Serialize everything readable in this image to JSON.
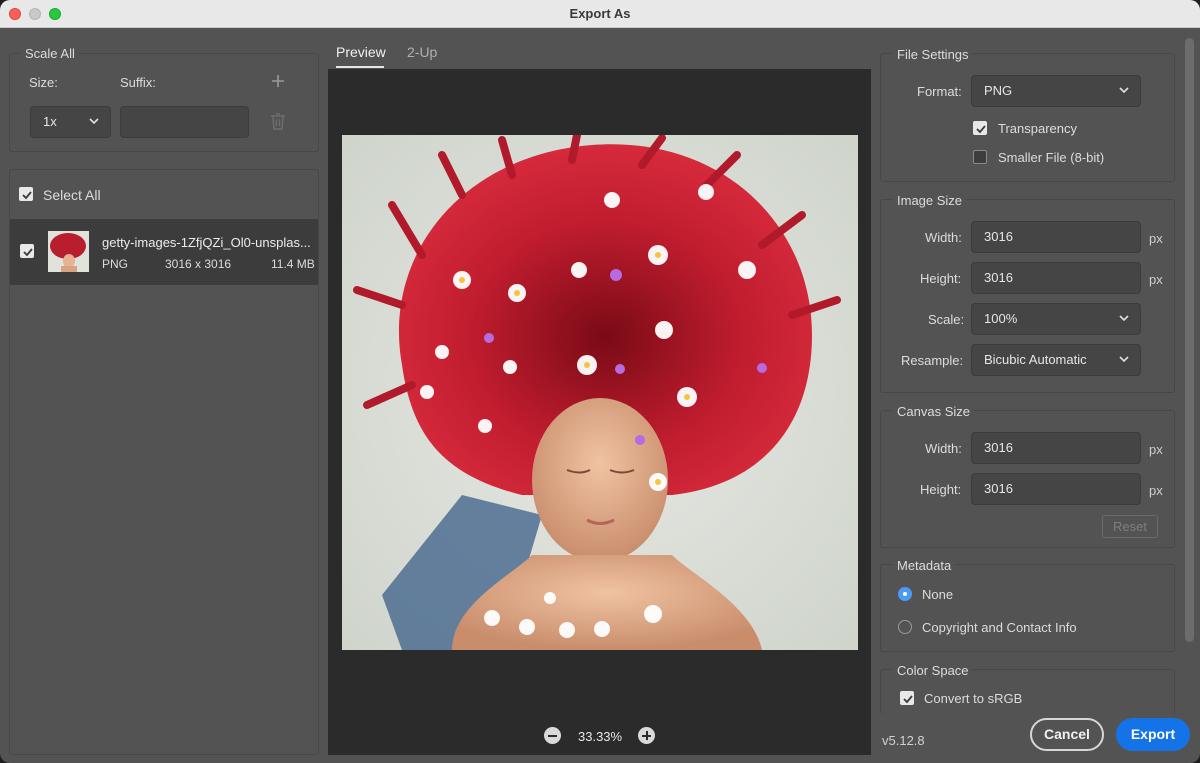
{
  "window": {
    "title": "Export As"
  },
  "left": {
    "scale_all_label": "Scale All",
    "size_label": "Size:",
    "suffix_label": "Suffix:",
    "size_value": "1x",
    "suffix_value": "",
    "select_all_label": "Select All",
    "file": {
      "name": "getty-images-1ZfjQZi_Ol0-unsplas...",
      "format": "PNG",
      "dimensions": "3016 x 3016",
      "size": "11.4 MB"
    }
  },
  "center": {
    "tabs": [
      {
        "label": "Preview",
        "active": true
      },
      {
        "label": "2-Up",
        "active": false
      }
    ],
    "zoom": "33.33%"
  },
  "right": {
    "file_settings": {
      "label": "File Settings",
      "format_label": "Format:",
      "format_value": "PNG",
      "transparency_label": "Transparency",
      "transparency_checked": true,
      "smaller_file_label": "Smaller File (8-bit)",
      "smaller_file_checked": false
    },
    "image_size": {
      "label": "Image Size",
      "width_label": "Width:",
      "width_value": "3016",
      "height_label": "Height:",
      "height_value": "3016",
      "scale_label": "Scale:",
      "scale_value": "100%",
      "resample_label": "Resample:",
      "resample_value": "Bicubic Automatic",
      "unit": "px"
    },
    "canvas_size": {
      "label": "Canvas Size",
      "width_label": "Width:",
      "width_value": "3016",
      "height_label": "Height:",
      "height_value": "3016",
      "unit": "px",
      "reset_label": "Reset"
    },
    "metadata": {
      "label": "Metadata",
      "options": [
        "None",
        "Copyright and Contact Info"
      ],
      "selected": "None"
    },
    "color_space": {
      "label": "Color Space",
      "convert_label": "Convert to sRGB",
      "convert_checked": true
    }
  },
  "footer": {
    "version": "v5.12.8",
    "cancel_label": "Cancel",
    "export_label": "Export"
  },
  "colors": {
    "accent": "#1473e6",
    "radio_selected": "#4a9bf5",
    "panel_bg": "#535353",
    "preview_bg": "#2b2b2b"
  }
}
